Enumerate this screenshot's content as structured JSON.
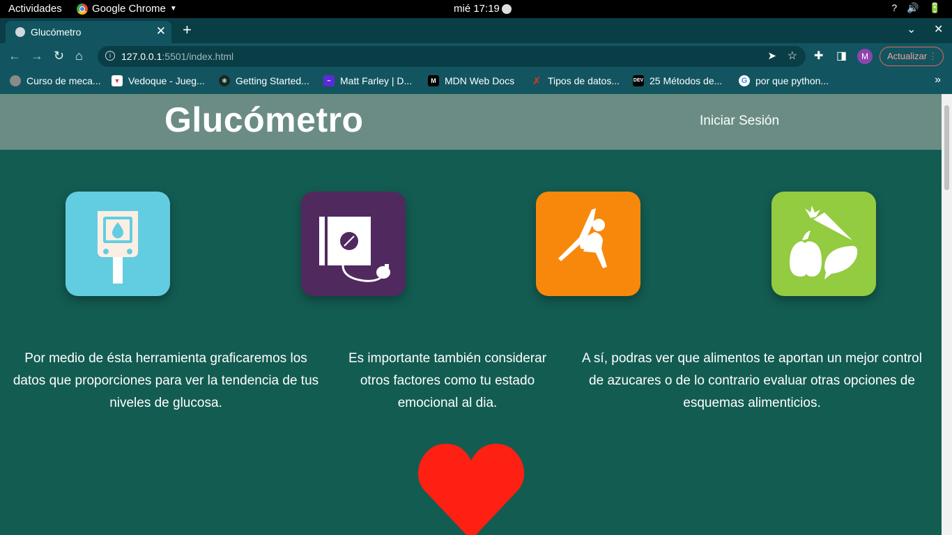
{
  "os": {
    "activities": "Actividades",
    "app_name": "Google Chrome",
    "clock": "mié 17:19",
    "tray": [
      "?",
      "🔊",
      "🔋"
    ]
  },
  "browser": {
    "tab_title": "Glucómetro",
    "url_host": "127.0.0.1",
    "url_path": ":5501/index.html",
    "avatar_letter": "M",
    "update_label": "Actualizar",
    "bookmarks": [
      {
        "label": "Curso de meca...",
        "icon": "globe-icon",
        "color": "#8a8a8a"
      },
      {
        "label": "Vedoque - Jueg...",
        "icon": "vedoque-icon",
        "color": "#d9342b"
      },
      {
        "label": "Getting Started...",
        "icon": "react-icon",
        "color": "#222222"
      },
      {
        "label": "Matt Farley | D...",
        "icon": "matt-icon",
        "color": "#5b2bd9"
      },
      {
        "label": "MDN Web Docs",
        "icon": "mdn-icon",
        "color": "#000000"
      },
      {
        "label": "Tipos de datos...",
        "icon": "x-icon",
        "color": "#c0392b"
      },
      {
        "label": "25 Métodos de...",
        "icon": "dev-icon",
        "color": "#000000"
      },
      {
        "label": "por que python...",
        "icon": "google-icon",
        "color": "#ffffff"
      }
    ]
  },
  "site": {
    "title": "Glucómetro",
    "login": "Iniciar Sesión",
    "tiles": [
      {
        "icon": "glucometer-icon",
        "color": "#62cde0"
      },
      {
        "icon": "blood-pressure-monitor-icon",
        "color": "#502a5f"
      },
      {
        "icon": "exercise-icon",
        "color": "#f7880b"
      },
      {
        "icon": "vegetables-icon",
        "color": "#93cb41"
      }
    ],
    "paragraphs": [
      "Por medio de ésta herramienta graficaremos los datos que proporciones para ver la tendencia de tus niveles de glucosa.",
      "Es importante también considerar otros factores como tu estado emocional al dia.",
      "A sí, podras ver que alimentos te aportan un mejor control de azucares o de lo contrario evaluar otras opciones de esquemas alimenticios."
    ],
    "heart_color": "#fe2012"
  }
}
